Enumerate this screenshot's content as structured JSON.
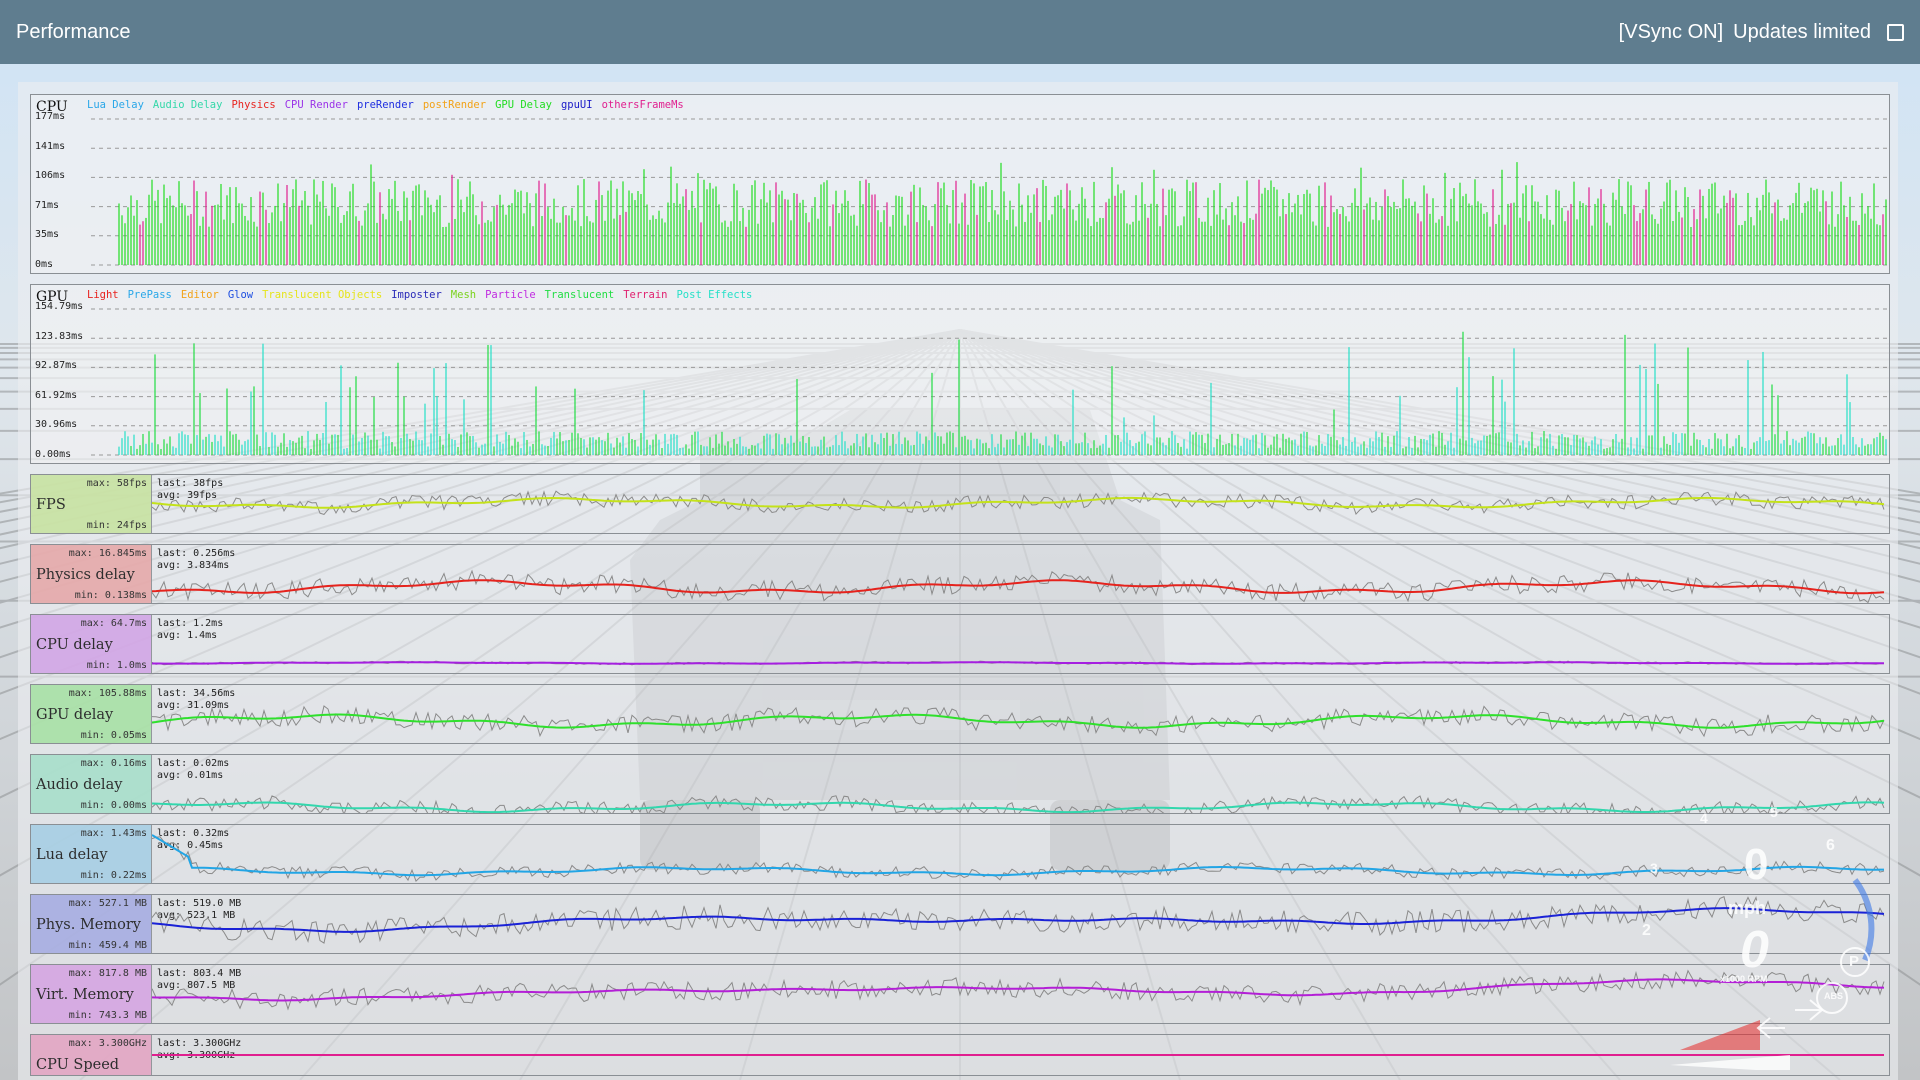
{
  "window": {
    "title": "Performance",
    "vsync": "[VSync ON]",
    "updates_limited": "Updates limited"
  },
  "cpu_graph": {
    "name": "CPU",
    "legend": [
      {
        "label": "Lua Delay",
        "color": "#2aa7e8"
      },
      {
        "label": "Audio Delay",
        "color": "#34d8a9"
      },
      {
        "label": "Physics",
        "color": "#e8231f"
      },
      {
        "label": "CPU Render",
        "color": "#9b34e8"
      },
      {
        "label": "preRender",
        "color": "#1f2fe0"
      },
      {
        "label": "postRender",
        "color": "#f2a218"
      },
      {
        "label": "GPU Delay",
        "color": "#22dd22"
      },
      {
        "label": "gpuUI",
        "color": "#1c1cc8"
      },
      {
        "label": "othersFrameMs",
        "color": "#e0208f"
      }
    ],
    "yticks": [
      "177ms",
      "141ms",
      "106ms",
      "71ms",
      "35ms",
      "0ms"
    ]
  },
  "gpu_graph": {
    "name": "GPU",
    "legend": [
      {
        "label": "Light",
        "color": "#e8231f"
      },
      {
        "label": "PrePass",
        "color": "#2aa7e8"
      },
      {
        "label": "Editor",
        "color": "#f2a218"
      },
      {
        "label": "Glow",
        "color": "#1f4fe0"
      },
      {
        "label": "Translucent Objects",
        "color": "#e6e41c"
      },
      {
        "label": "Imposter",
        "color": "#2a2ab8"
      },
      {
        "label": "Mesh",
        "color": "#7ad21c"
      },
      {
        "label": "Particle",
        "color": "#c02be0"
      },
      {
        "label": "Translucent",
        "color": "#22dd44"
      },
      {
        "label": "Terrain",
        "color": "#e0206f"
      },
      {
        "label": "Post Effects",
        "color": "#26e0c8"
      }
    ],
    "yticks": [
      "154.79ms",
      "123.83ms",
      "92.87ms",
      "61.92ms",
      "30.96ms",
      "0.00ms"
    ]
  },
  "rows": [
    {
      "name": "FPS",
      "max": "max: 58fps",
      "min": "min: 24fps",
      "last": "last: 38fps",
      "avg": "avg: 39fps",
      "bg": "#c8e3a2",
      "line": "#c4e21a"
    },
    {
      "name": "Physics delay",
      "max": "max: 16.845ms",
      "min": "min: 0.138ms",
      "last": "last: 0.256ms",
      "avg": "avg: 3.834ms",
      "bg": "#e6a9aa",
      "line": "#e5231d"
    },
    {
      "name": "CPU delay",
      "max": "max: 64.7ms",
      "min": "min: 1.0ms",
      "last": "last: 1.2ms",
      "avg": "avg: 1.4ms",
      "bg": "#d2a6e6",
      "line": "#a51fe0"
    },
    {
      "name": "GPU delay",
      "max": "max: 105.88ms",
      "min": "min: 0.05ms",
      "last": "last: 34.56ms",
      "avg": "avg: 31.09ms",
      "bg": "#a8e1a6",
      "line": "#2fe02c"
    },
    {
      "name": "Audio delay",
      "max": "max: 0.16ms",
      "min": "min: 0.00ms",
      "last": "last: 0.02ms",
      "avg": "avg: 0.01ms",
      "bg": "#a8dfcb",
      "line": "#32d7ad"
    },
    {
      "name": "Lua delay",
      "max": "max: 1.43ms",
      "min": "min: 0.22ms",
      "last": "last: 0.32ms",
      "avg": "avg: 0.45ms",
      "bg": "#a7cfe4",
      "line": "#22a5e5"
    },
    {
      "name": "Phys. Memory",
      "max": "max: 527.1 MB",
      "min": "min: 459.4 MB",
      "last": "last: 519.0 MB",
      "avg": "avg: 523.1 MB",
      "bg": "#a7aee2",
      "line": "#1a22d6"
    },
    {
      "name": "Virt. Memory",
      "max": "max: 817.8 MB",
      "min": "min: 743.3 MB",
      "last": "last: 803.4 MB",
      "avg": "avg: 807.5 MB",
      "bg": "#d6a6e2",
      "line": "#b31fd6"
    },
    {
      "name": "CPU Speed",
      "max": "max: 3.300GHz",
      "min": "",
      "last": "last: 3.300GHz",
      "avg": "avg: 3.300GHz",
      "bg": "#e3a6c4",
      "line": "#e01f8f"
    }
  ],
  "hud": {
    "speed": "0",
    "unit": "mph",
    "gear": "0",
    "rpm_label": "x1000 RPM",
    "abs": "ABS",
    "park": "P",
    "ticks": [
      "2",
      "3",
      "4",
      "5",
      "6",
      "2"
    ]
  }
}
